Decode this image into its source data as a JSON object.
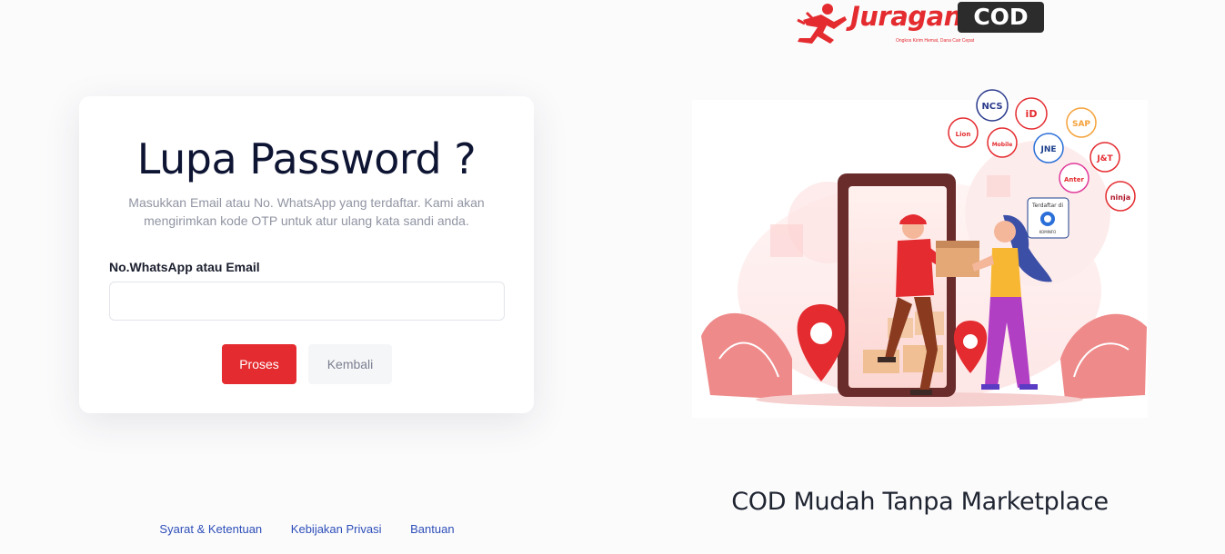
{
  "logo": {
    "brand": "Juragan",
    "brand_cod": "COD",
    "tagline": "Ongkos Kirim Hemat, Dana Cair Cepat"
  },
  "form": {
    "title": "Lupa Password ?",
    "description_line1": "Masukkan Email atau No. WhatsApp yang terdaftar. Kami akan",
    "description_line2": "mengirimkan kode OTP untuk atur ulang kata sandi anda.",
    "field_label": "No.WhatsApp atau Email",
    "field_value": "",
    "submit_label": "Proses",
    "back_label": "Kembali"
  },
  "footer": {
    "links": [
      "Syarat & Ketentuan",
      "Kebijakan Privasi",
      "Bantuan"
    ]
  },
  "illustration": {
    "headline": "COD Mudah Tanpa Marketplace",
    "couriers": [
      "NCS",
      "iD",
      "SAP",
      "J&T",
      "JNE",
      "ninja",
      "Lion",
      "Mobile",
      "Anter"
    ],
    "badge_line1": "Terdaftar di",
    "badge_line2": "KOMINFO"
  },
  "colors": {
    "primary": "#e42b2f",
    "background": "#fbfbfc",
    "title": "#0e1533",
    "link": "#2e4fb8"
  }
}
